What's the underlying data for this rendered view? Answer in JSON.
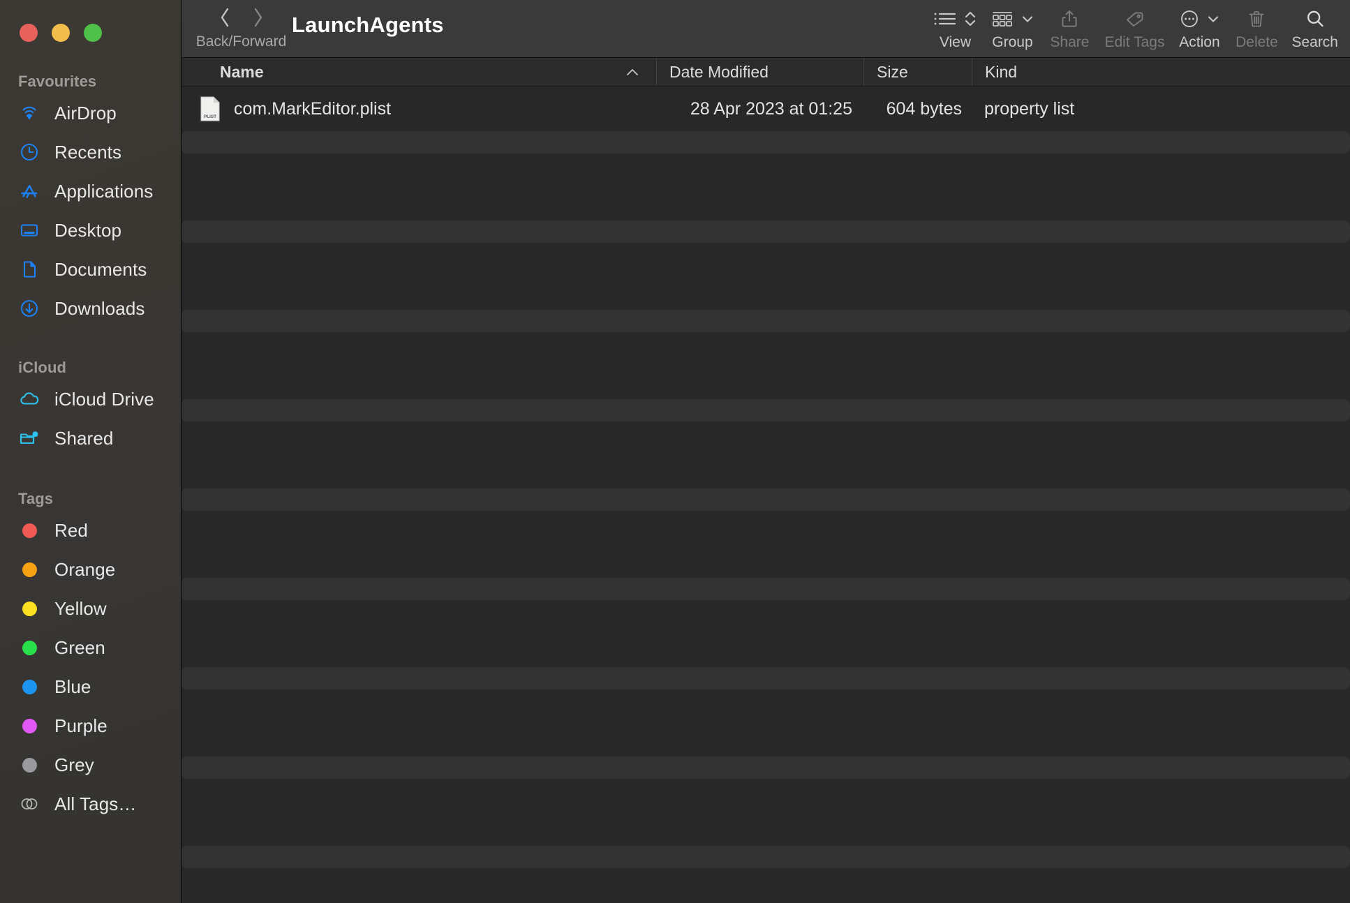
{
  "window": {
    "title": "LaunchAgents",
    "traffic_lights": [
      {
        "name": "close",
        "color": "#e8615a"
      },
      {
        "name": "minimize",
        "color": "#f2bd4c"
      },
      {
        "name": "maximize",
        "color": "#4fc14b"
      }
    ]
  },
  "toolbar": {
    "nav": {
      "caption": "Back/Forward",
      "back_icon": "chevron-left-icon",
      "forward_icon": "chevron-right-icon"
    },
    "buttons": [
      {
        "label": "View",
        "icon": "list-view-icon",
        "has_chevron": true,
        "chevron": "updown",
        "enabled": true
      },
      {
        "label": "Group",
        "icon": "grid-group-icon",
        "has_chevron": true,
        "chevron": "down",
        "enabled": true
      },
      {
        "label": "Share",
        "icon": "share-icon",
        "has_chevron": false,
        "chevron": "",
        "enabled": false
      },
      {
        "label": "Edit Tags",
        "icon": "tag-icon",
        "has_chevron": false,
        "chevron": "",
        "enabled": false
      },
      {
        "label": "Action",
        "icon": "ellipsis-circle-icon",
        "has_chevron": true,
        "chevron": "down",
        "enabled": true
      },
      {
        "label": "Delete",
        "icon": "trash-icon",
        "has_chevron": false,
        "chevron": "",
        "enabled": false
      },
      {
        "label": "Search",
        "icon": "search-icon",
        "has_chevron": false,
        "chevron": "",
        "enabled": true
      }
    ]
  },
  "sidebar": {
    "sections": [
      {
        "title": "Favourites",
        "items": [
          {
            "label": "AirDrop",
            "icon": "airdrop-icon",
            "color": "#1d82f5"
          },
          {
            "label": "Recents",
            "icon": "clock-icon",
            "color": "#1d82f5"
          },
          {
            "label": "Applications",
            "icon": "applications-icon",
            "color": "#1d82f5"
          },
          {
            "label": "Desktop",
            "icon": "desktop-icon",
            "color": "#1d82f5"
          },
          {
            "label": "Documents",
            "icon": "document-icon",
            "color": "#1d82f5"
          },
          {
            "label": "Downloads",
            "icon": "download-icon",
            "color": "#1d82f5"
          }
        ]
      },
      {
        "title": "iCloud",
        "items": [
          {
            "label": "iCloud Drive",
            "icon": "cloud-icon",
            "color": "#2cc3ee"
          },
          {
            "label": "Shared",
            "icon": "shared-folder-icon",
            "color": "#2cc3ee"
          }
        ]
      },
      {
        "title": "Tags",
        "items": [
          {
            "label": "Red",
            "icon": "tag-dot-red-icon",
            "color": "#f05a55"
          },
          {
            "label": "Orange",
            "icon": "tag-dot-orange-icon",
            "color": "#f5a213"
          },
          {
            "label": "Yellow",
            "icon": "tag-dot-yellow-icon",
            "color": "#fbdf20"
          },
          {
            "label": "Green",
            "icon": "tag-dot-green-icon",
            "color": "#2ae04a"
          },
          {
            "label": "Blue",
            "icon": "tag-dot-blue-icon",
            "color": "#1d94ef"
          },
          {
            "label": "Purple",
            "icon": "tag-dot-purple-icon",
            "color": "#e059f5"
          },
          {
            "label": "Grey",
            "icon": "tag-dot-grey-icon",
            "color": "#9b9b9f"
          },
          {
            "label": "All Tags…",
            "icon": "all-tags-icon",
            "color": "#b4b4b4"
          }
        ]
      }
    ]
  },
  "filelist": {
    "columns": [
      {
        "key": "name",
        "label": "Name",
        "sorted": true,
        "sort_direction": "ascending"
      },
      {
        "key": "date",
        "label": "Date Modified",
        "sorted": false,
        "sort_direction": ""
      },
      {
        "key": "size",
        "label": "Size",
        "sorted": false,
        "sort_direction": ""
      },
      {
        "key": "kind",
        "label": "Kind",
        "sorted": false,
        "sort_direction": ""
      }
    ],
    "rows": [
      {
        "name": "com.MarkEditor.plist",
        "icon": "plist-file-icon",
        "icon_label": "PLIST",
        "date": "28 Apr 2023 at 01:25",
        "size": "604 bytes",
        "kind": "property list"
      }
    ]
  }
}
